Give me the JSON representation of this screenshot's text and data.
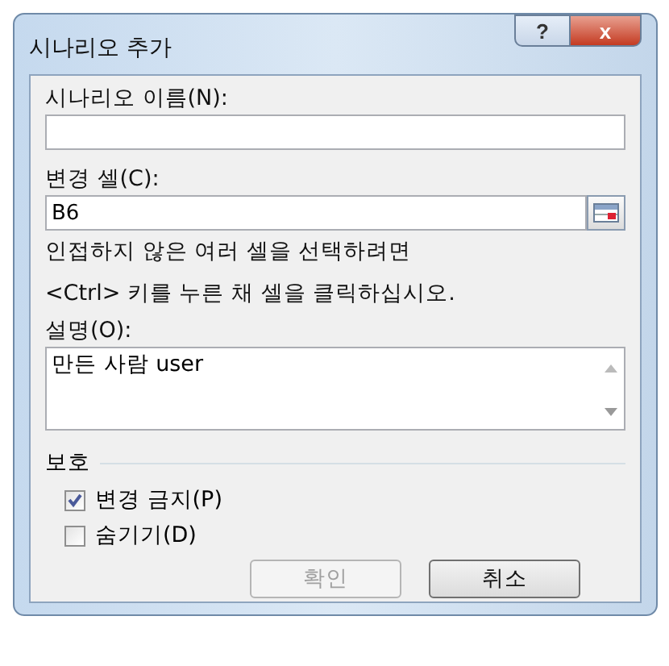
{
  "window": {
    "title": "시나리오 추가",
    "help_button": "?",
    "close_button": "x"
  },
  "name_field": {
    "label": "시나리오 이름(N):"
  },
  "changing_cells": {
    "label": "변경 셀(C):",
    "value": "B6"
  },
  "hint_lines": [
    "인접하지 않은 여러 셀을 선택하려면",
    "<Ctrl> 키를 누른 채 셀을 클릭하십시오."
  ],
  "comment": {
    "label": "설명(O):",
    "value": "만든 사람 user"
  },
  "protection": {
    "title": "보호",
    "options": [
      {
        "label": "변경 금지(P)",
        "checked": true
      },
      {
        "label": "숨기기(D)",
        "checked": false
      }
    ]
  },
  "buttons": [
    {
      "label": "확인",
      "disabled": true
    },
    {
      "label": "취소",
      "disabled": false
    }
  ]
}
